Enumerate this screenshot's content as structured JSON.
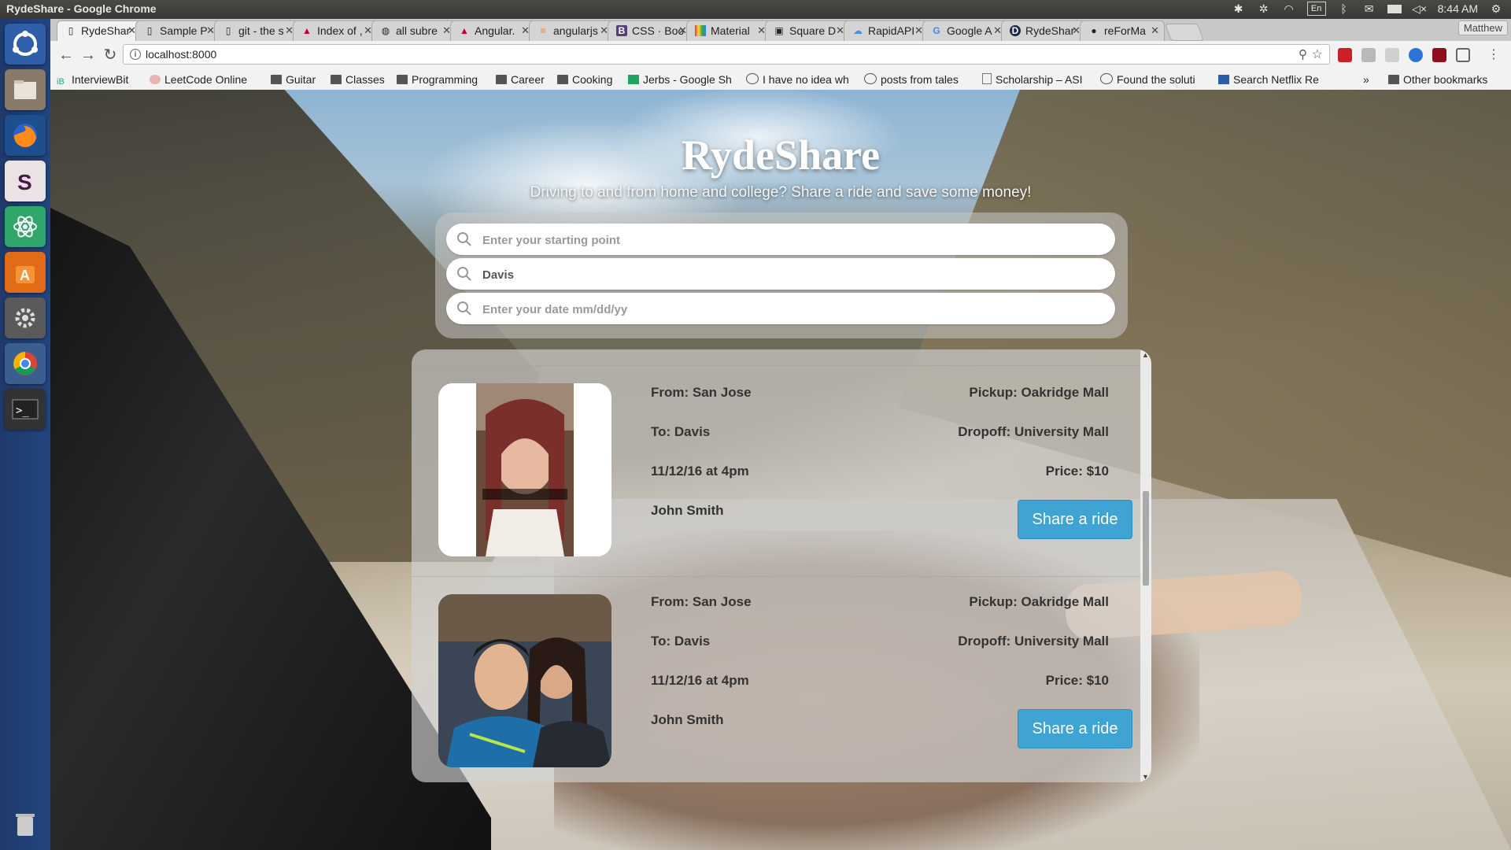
{
  "os": {
    "window_title": "RydeShare - Google Chrome",
    "clock": "8:44 AM",
    "keyboard_layout": "En",
    "launcher_items": [
      "ubuntu-dash",
      "files",
      "firefox",
      "slack",
      "atom",
      "software-center",
      "system-settings",
      "chrome",
      "terminal",
      "trash"
    ]
  },
  "browser": {
    "tabs": [
      {
        "label": "RydeShar",
        "icon": "page-icon",
        "active": true
      },
      {
        "label": "Sample P",
        "icon": "page-icon"
      },
      {
        "label": "git - the s",
        "icon": "page-icon"
      },
      {
        "label": "Index of ,",
        "icon": "angular-icon"
      },
      {
        "label": "all subre",
        "icon": "reddit-icon"
      },
      {
        "label": "Angular.",
        "icon": "angular-icon"
      },
      {
        "label": "angularjs",
        "icon": "stackoverflow-icon"
      },
      {
        "label": "CSS · Boo",
        "icon": "bootstrap-icon"
      },
      {
        "label": "Material",
        "icon": "material-icon"
      },
      {
        "label": "Square D",
        "icon": "square-icon"
      },
      {
        "label": "RapidAPI",
        "icon": "rapidapi-icon"
      },
      {
        "label": "Google A",
        "icon": "google-icon"
      },
      {
        "label": "RydeShar",
        "icon": "d-icon"
      },
      {
        "label": "reForMa",
        "icon": "github-icon"
      }
    ],
    "profile": "Matthew",
    "url": "localhost:8000",
    "bookmarks": [
      {
        "label": "InterviewBit",
        "icon": "interviewbit-icon"
      },
      {
        "label": "LeetCode Online",
        "icon": "leetcode-icon"
      },
      {
        "label": "Guitar",
        "icon": "folder-icon"
      },
      {
        "label": "Classes",
        "icon": "folder-icon"
      },
      {
        "label": "Programming",
        "icon": "folder-icon"
      },
      {
        "label": "Career",
        "icon": "folder-icon"
      },
      {
        "label": "Cooking",
        "icon": "folder-icon"
      },
      {
        "label": "Jerbs - Google Sh",
        "icon": "sheets-icon"
      },
      {
        "label": "I have no idea wh",
        "icon": "reddit-icon"
      },
      {
        "label": "posts from tales",
        "icon": "reddit-icon"
      },
      {
        "label": "Scholarship – ASI",
        "icon": "page-icon"
      },
      {
        "label": "Found the soluti",
        "icon": "reddit-icon"
      },
      {
        "label": "Search Netflix Re",
        "icon": "netflix-icon"
      }
    ],
    "bookmarks_overflow": "»",
    "other_bookmarks": "Other bookmarks"
  },
  "app": {
    "brand": "RydeShare",
    "tagline": "Driving to and from home and college? Share a ride and save some money!",
    "search": {
      "start": {
        "value": "",
        "placeholder": "Enter your starting point"
      },
      "destination": {
        "value": "Davis",
        "placeholder": ""
      },
      "date": {
        "value": "",
        "placeholder": "Enter your date mm/dd/yy"
      }
    },
    "rides": [
      {
        "from": "From: San Jose",
        "to": "To: Davis",
        "when": "11/12/16 at 4pm",
        "driver": "John Smith",
        "pickup": "Pickup: Oakridge Mall",
        "dropoff": "Dropoff: University Mall",
        "price": "Price: $10",
        "button": "Share a ride"
      },
      {
        "from": "From: San Jose",
        "to": "To: Davis",
        "when": "11/12/16 at 4pm",
        "driver": "John Smith",
        "pickup": "Pickup: Oakridge Mall",
        "dropoff": "Dropoff: University Mall",
        "price": "Price: $10",
        "button": "Share a ride"
      }
    ]
  },
  "colors": {
    "accent": "#3fa3d3",
    "launcher": "#22457f"
  }
}
